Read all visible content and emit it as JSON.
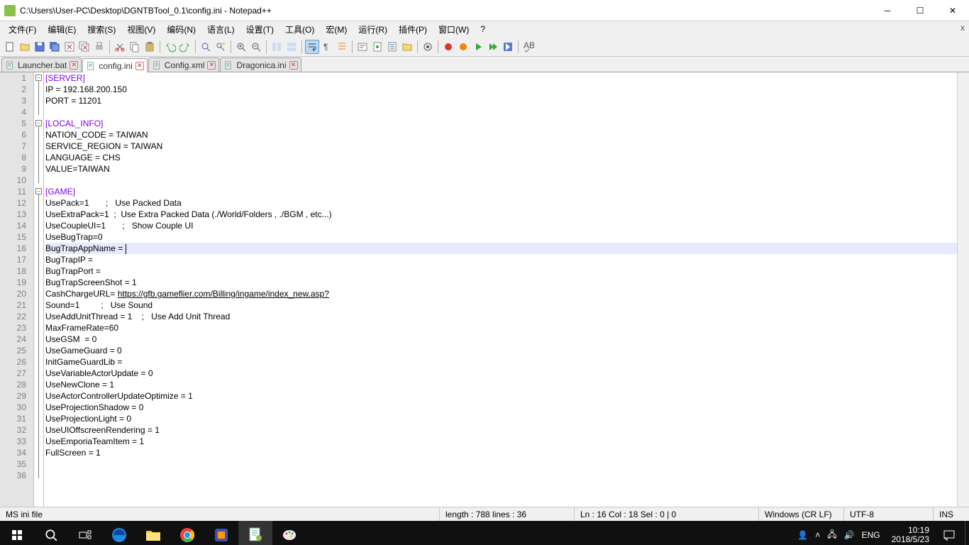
{
  "window": {
    "title": "C:\\Users\\User-PC\\Desktop\\DGNTBTool_0.1\\config.ini - Notepad++"
  },
  "menu": {
    "items": [
      "文件(F)",
      "编辑(E)",
      "搜索(S)",
      "视图(V)",
      "编码(N)",
      "语言(L)",
      "设置(T)",
      "工具(O)",
      "宏(M)",
      "运行(R)",
      "插件(P)",
      "窗口(W)",
      "?"
    ]
  },
  "tabs": [
    {
      "label": "Launcher.bat",
      "active": false
    },
    {
      "label": "config.ini",
      "active": true
    },
    {
      "label": "Config.xml",
      "active": false
    },
    {
      "label": "Dragonica.ini",
      "active": false
    }
  ],
  "lines": [
    {
      "n": 1,
      "type": "section",
      "text": "[SERVER]"
    },
    {
      "n": 2,
      "type": "plain",
      "text": "IP = 192.168.200.150"
    },
    {
      "n": 3,
      "type": "plain",
      "text": "PORT = 11201"
    },
    {
      "n": 4,
      "type": "plain",
      "text": ""
    },
    {
      "n": 5,
      "type": "section",
      "text": "[LOCAL_INFO]"
    },
    {
      "n": 6,
      "type": "plain",
      "text": "NATION_CODE = TAIWAN"
    },
    {
      "n": 7,
      "type": "plain",
      "text": "SERVICE_REGION = TAIWAN"
    },
    {
      "n": 8,
      "type": "plain",
      "text": "LANGUAGE = CHS"
    },
    {
      "n": 9,
      "type": "plain",
      "text": "VALUE=TAIWAN"
    },
    {
      "n": 10,
      "type": "plain",
      "text": ""
    },
    {
      "n": 11,
      "type": "section",
      "text": "[GAME]"
    },
    {
      "n": 12,
      "type": "plain",
      "text": "UsePack=1       ;   Use Packed Data"
    },
    {
      "n": 13,
      "type": "plain",
      "text": "UseExtraPack=1  ;  Use Extra Packed Data (./World/Folders , ./BGM , etc...)"
    },
    {
      "n": 14,
      "type": "plain",
      "text": "UseCoupleUI=1       ;   Show Couple UI"
    },
    {
      "n": 15,
      "type": "plain",
      "text": "UseBugTrap=0"
    },
    {
      "n": 16,
      "type": "plain",
      "text": "BugTrapAppName = ",
      "hl": true,
      "caret": true
    },
    {
      "n": 17,
      "type": "plain",
      "text": "BugTrapIP ="
    },
    {
      "n": 18,
      "type": "plain",
      "text": "BugTrapPort ="
    },
    {
      "n": 19,
      "type": "plain",
      "text": "BugTrapScreenShot = 1"
    },
    {
      "n": 20,
      "type": "url",
      "prefix": "CashChargeURL= ",
      "url": "https://gfb.gameflier.com/Billing/ingame/index_new.asp?"
    },
    {
      "n": 21,
      "type": "plain",
      "text": "Sound=1         ;   Use Sound"
    },
    {
      "n": 22,
      "type": "plain",
      "text": "UseAddUnitThread = 1    ;   Use Add Unit Thread"
    },
    {
      "n": 23,
      "type": "plain",
      "text": "MaxFrameRate=60"
    },
    {
      "n": 24,
      "type": "plain",
      "text": "UseGSM  = 0"
    },
    {
      "n": 25,
      "type": "plain",
      "text": "UseGameGuard = 0"
    },
    {
      "n": 26,
      "type": "plain",
      "text": "InitGameGuardLib ="
    },
    {
      "n": 27,
      "type": "plain",
      "text": "UseVariableActorUpdate = 0"
    },
    {
      "n": 28,
      "type": "plain",
      "text": "UseNewClone = 1"
    },
    {
      "n": 29,
      "type": "plain",
      "text": "UseActorControllerUpdateOptimize = 1"
    },
    {
      "n": 30,
      "type": "plain",
      "text": "UseProjectionShadow = 0"
    },
    {
      "n": 31,
      "type": "plain",
      "text": "UseProjectionLight = 0"
    },
    {
      "n": 32,
      "type": "plain",
      "text": "UseUIOffscreenRendering = 1"
    },
    {
      "n": 33,
      "type": "plain",
      "text": "UseEmporiaTeamItem = 1"
    },
    {
      "n": 34,
      "type": "plain",
      "text": "FullScreen = 1"
    },
    {
      "n": 35,
      "type": "plain",
      "text": ""
    },
    {
      "n": 36,
      "type": "plain",
      "text": ""
    }
  ],
  "fold_boxes": [
    1,
    5,
    11
  ],
  "status": {
    "filetype": "MS ini file",
    "length": "length : 788    lines : 36",
    "pos": "Ln : 16    Col : 18    Sel : 0 | 0",
    "eol": "Windows (CR LF)",
    "enc": "UTF-8",
    "ins": "INS"
  },
  "taskbar": {
    "lang": "ENG",
    "time": "10:19",
    "date": "2018/5/23"
  }
}
